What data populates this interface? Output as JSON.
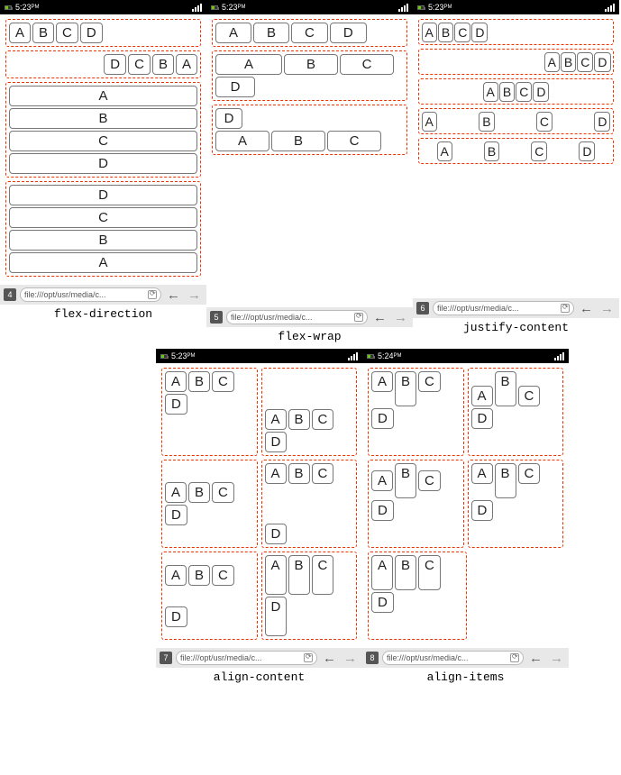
{
  "status": {
    "time": "5:23",
    "ampm": "PM",
    "time_alt": "5:24"
  },
  "items": {
    "A": "A",
    "B": "B",
    "C": "C",
    "D": "D"
  },
  "url": "file:///opt/usr/media/c...",
  "captions": {
    "p4": "flex-direction",
    "p5": "flex-wrap",
    "p6": "justify-content",
    "p7": "align-content",
    "p8": "align-items"
  },
  "badges": {
    "p4": "4",
    "p5": "5",
    "p6": "6",
    "p7": "7",
    "p8": "8"
  }
}
